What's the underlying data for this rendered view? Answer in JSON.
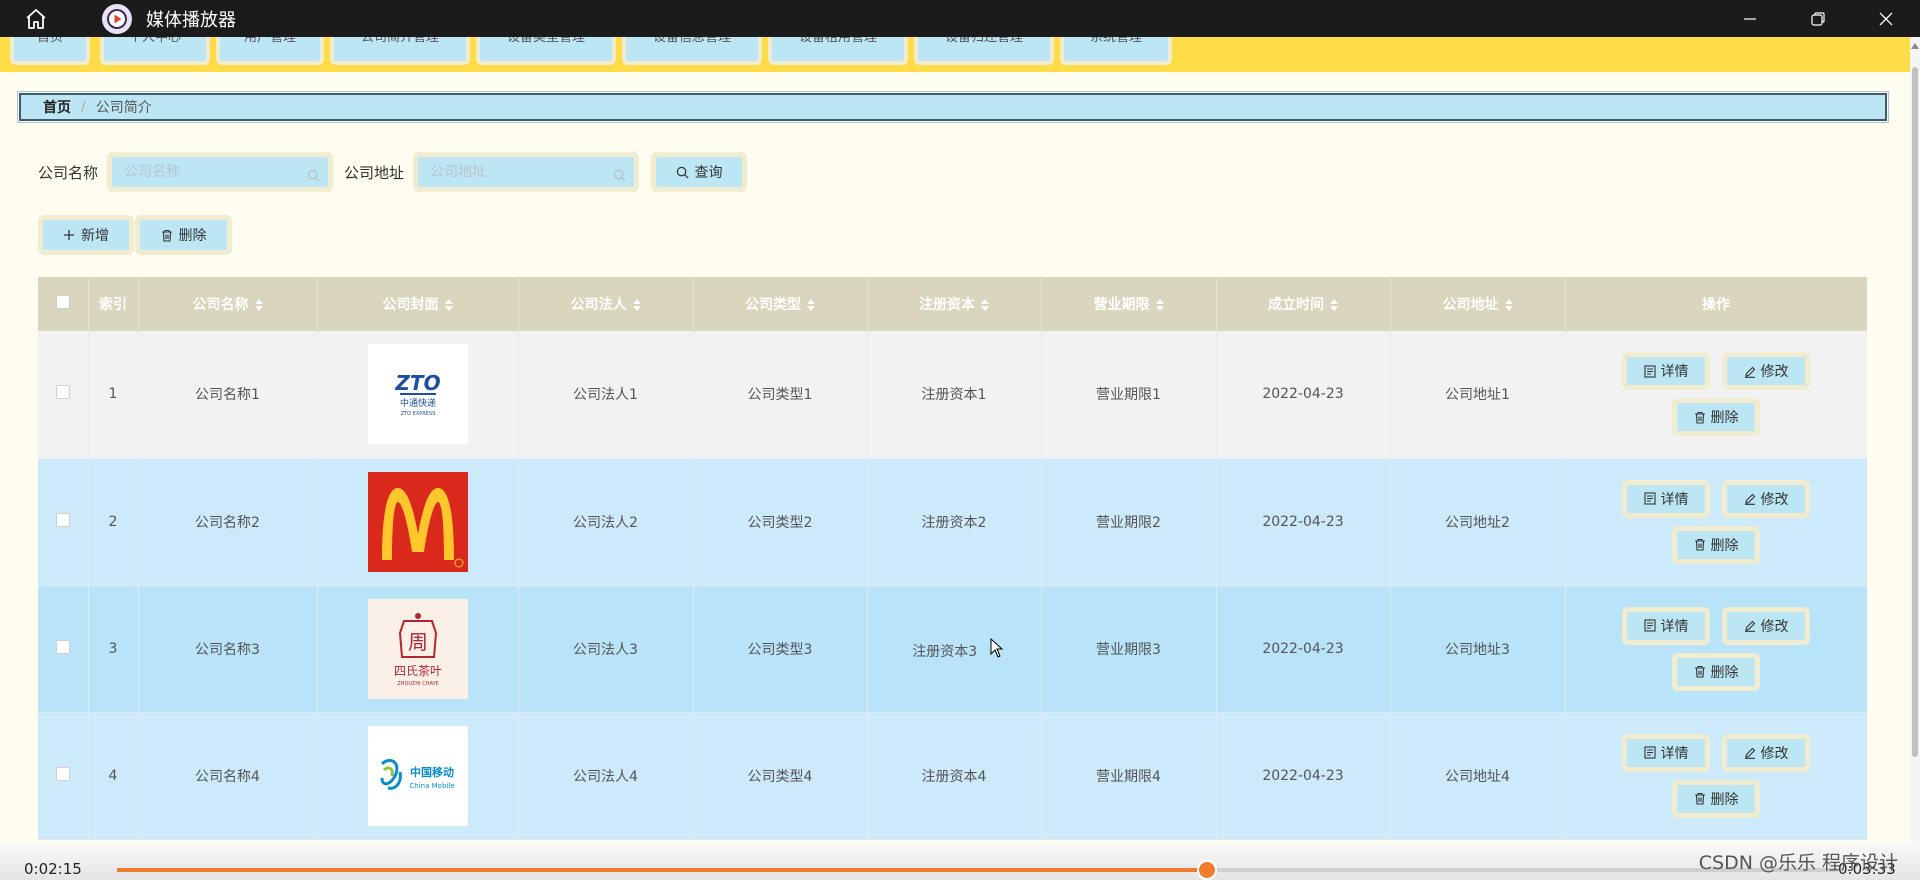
{
  "window": {
    "title": "媒体播放器"
  },
  "nav": {
    "tabs": [
      {
        "label": "首页"
      },
      {
        "label": "个人中心"
      },
      {
        "label": "用户管理"
      },
      {
        "label": "公司简介管理"
      },
      {
        "label": "设备类型管理"
      },
      {
        "label": "设备信息管理"
      },
      {
        "label": "设备租用管理"
      },
      {
        "label": "设备归还管理"
      },
      {
        "label": "系统管理"
      }
    ]
  },
  "breadcrumb": {
    "home": "首页",
    "separator": "/",
    "current": "公司简介"
  },
  "search": {
    "name_label": "公司名称",
    "name_placeholder": "公司名称",
    "address_label": "公司地址",
    "address_placeholder": "公司地址",
    "query_button": "查询"
  },
  "actions": {
    "add_button": "新增",
    "delete_button": "删除"
  },
  "table": {
    "columns": [
      "索引",
      "公司名称",
      "公司封面",
      "公司法人",
      "公司类型",
      "注册资本",
      "营业期限",
      "成立时间",
      "公司地址",
      "操作"
    ],
    "rows": [
      {
        "index": "1",
        "name": "公司名称1",
        "cover": "ZTO 中通快递 ZTO EXPRESS",
        "legal": "公司法人1",
        "type": "公司类型1",
        "capital": "注册资本1",
        "term": "营业期限1",
        "date": "2022-04-23",
        "address": "公司地址1"
      },
      {
        "index": "2",
        "name": "公司名称2",
        "cover": "McDonald's",
        "legal": "公司法人2",
        "type": "公司类型2",
        "capital": "注册资本2",
        "term": "营业期限2",
        "date": "2022-04-23",
        "address": "公司地址2"
      },
      {
        "index": "3",
        "name": "公司名称3",
        "cover": "周 四氏茶叶 ZHOUZHI CHAYE",
        "legal": "公司法人3",
        "type": "公司类型3",
        "capital": "注册资本3",
        "term": "营业期限3",
        "date": "2022-04-23",
        "address": "公司地址3"
      },
      {
        "index": "4",
        "name": "公司名称4",
        "cover": "中国移动 China Mobile",
        "legal": "公司法人4",
        "type": "公司类型4",
        "capital": "注册资本4",
        "term": "营业期限4",
        "date": "2022-04-23",
        "address": "公司地址4"
      }
    ],
    "row_actions": {
      "detail": "详情",
      "edit": "修改",
      "delete": "删除"
    }
  },
  "logos": {
    "zto_main": "ZTO",
    "zto_cn": "中通快递",
    "zto_en": "ZTO EXPRESS",
    "zhouzhi_char": "周",
    "zhouzhi_cn": "四氏茶叶",
    "zhouzhi_en": "ZHOUZHI CHAYE",
    "cmcc_cn": "中国移动",
    "cmcc_en": "China Mobile"
  },
  "player": {
    "elapsed": "0:02:15",
    "total": "0:03:33",
    "progress": 0.6338,
    "watermark": "CSDN @乐乐 程序设计"
  },
  "colors": {
    "accent_yellow": "#fedc47",
    "light_blue": "#bde6f5",
    "header_beige": "#d9d6bd",
    "progress_orange": "#f07d2e",
    "mcd_red": "#da291c",
    "mcd_yellow": "#ffc72c"
  }
}
